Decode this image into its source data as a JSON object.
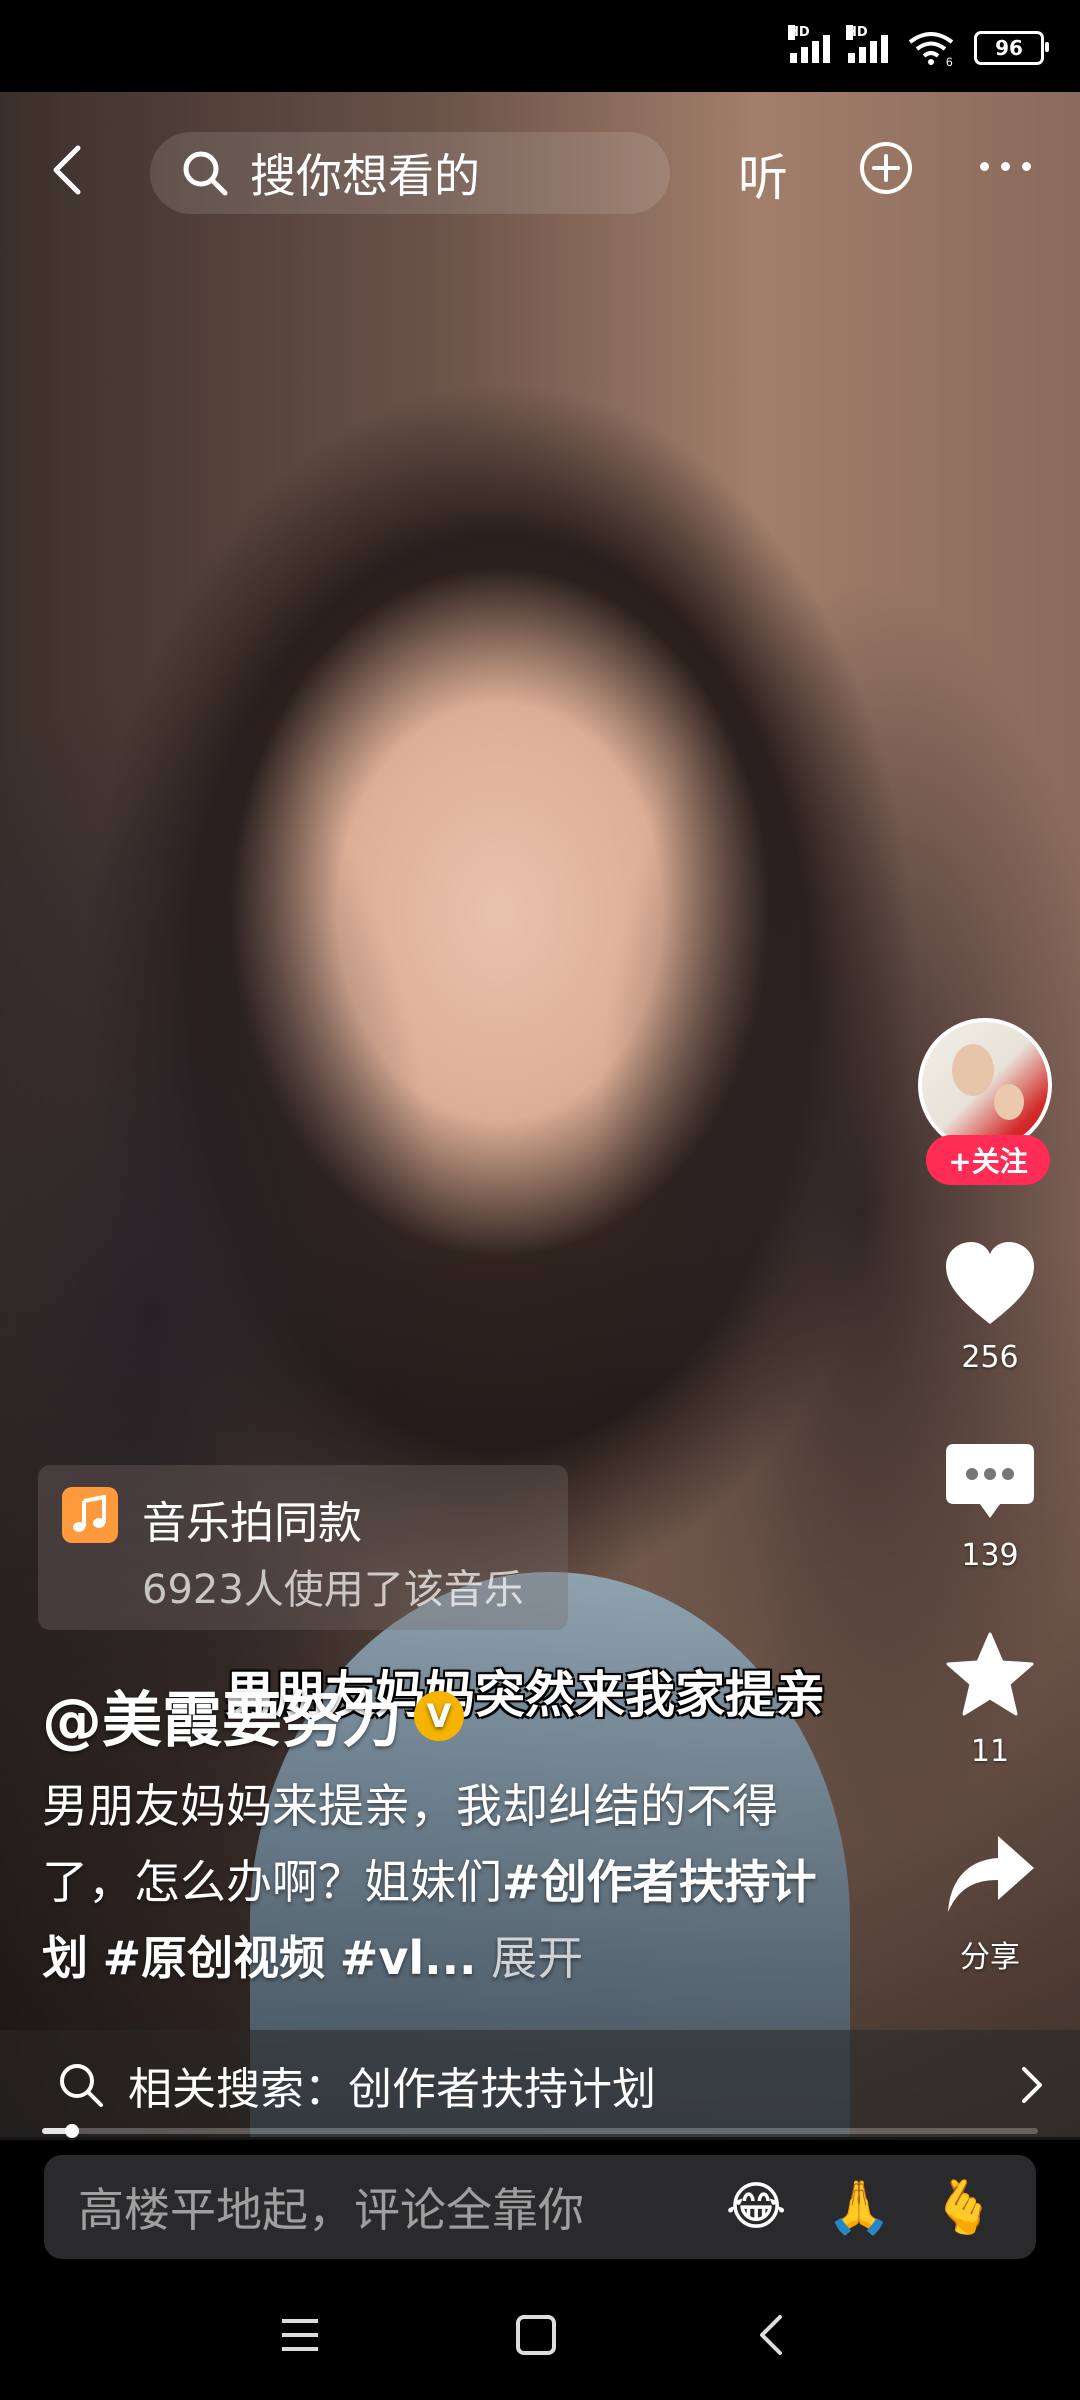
{
  "status_bar": {
    "battery": "96",
    "signal_labels": [
      "HD",
      "HD"
    ],
    "wifi_label": "6"
  },
  "top_bar": {
    "search_placeholder": "搜你想看的",
    "listen_label": "听"
  },
  "right_rail": {
    "follow_label": "+关注",
    "likes": "256",
    "comments": "139",
    "favorites": "11",
    "share_label": "分享"
  },
  "music": {
    "title": "音乐拍同款",
    "usage": "6923人使用了该音乐"
  },
  "subtitle": "男朋友妈妈突然来我家提亲",
  "post": {
    "author": "@美霞要努力",
    "verified_badge": "V",
    "description_text": "男朋友妈妈来提亲，我却纠结的不得了，怎么办啊？姐妹们",
    "tags": [
      "#创作者扶持计划",
      "#原创视频",
      "#vl..."
    ],
    "expand_label": "展开"
  },
  "related_search": {
    "label": "相关搜索：创作者扶持计划"
  },
  "progress": {
    "played_fraction": 0.03
  },
  "comment_bar": {
    "placeholder": "高楼平地起，评论全靠你",
    "emojis": [
      "😂",
      "🙏",
      "🫰"
    ]
  },
  "colors": {
    "accent_red": "#ff2c55",
    "badge_yellow": "#f5b400",
    "music_orange": "#ff9a3c"
  },
  "icons": [
    "back-icon",
    "search-icon",
    "plus-circle-icon",
    "more-icon",
    "heart-icon",
    "comment-icon",
    "star-icon",
    "share-icon",
    "music-note-icon",
    "chevron-right-icon",
    "menu-icon",
    "home-square-icon",
    "back-triangle-icon"
  ]
}
